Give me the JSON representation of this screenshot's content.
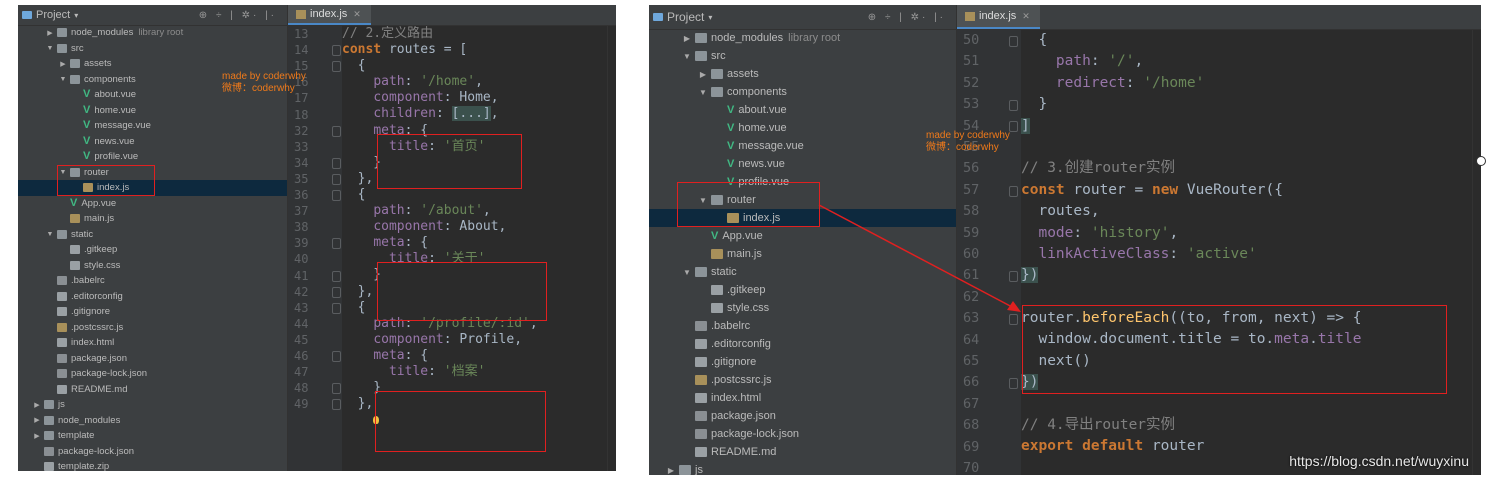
{
  "left": {
    "project_label": "Project",
    "toolbar_icons": "⊕ ÷ | ✲· |·",
    "tab": "index.js",
    "tree": [
      {
        "label": "node_modules",
        "extra": "library root",
        "icon": "folder",
        "arrow": "▶",
        "indent": 1
      },
      {
        "label": "src",
        "icon": "folder",
        "arrow": "▼",
        "indent": 1
      },
      {
        "label": "assets",
        "icon": "folder",
        "arrow": "▶",
        "indent": 2
      },
      {
        "label": "components",
        "icon": "folder",
        "arrow": "▼",
        "indent": 2
      },
      {
        "label": "about.vue",
        "icon": "vue",
        "indent": 3
      },
      {
        "label": "home.vue",
        "icon": "vue",
        "indent": 3
      },
      {
        "label": "message.vue",
        "icon": "vue",
        "indent": 3
      },
      {
        "label": "news.vue",
        "icon": "vue",
        "indent": 3
      },
      {
        "label": "profile.vue",
        "icon": "vue",
        "indent": 3
      },
      {
        "label": "router",
        "icon": "folder",
        "arrow": "▼",
        "indent": 2
      },
      {
        "label": "index.js",
        "icon": "js",
        "indent": 3,
        "selected": true
      },
      {
        "label": "App.vue",
        "icon": "vue",
        "indent": 2
      },
      {
        "label": "main.js",
        "icon": "js",
        "indent": 2
      },
      {
        "label": "static",
        "icon": "folder",
        "arrow": "▼",
        "indent": 1
      },
      {
        "label": ".gitkeep",
        "icon": "file",
        "indent": 2
      },
      {
        "label": "style.css",
        "icon": "file",
        "indent": 2
      },
      {
        "label": ".babelrc",
        "icon": "json",
        "indent": 1
      },
      {
        "label": ".editorconfig",
        "icon": "file",
        "indent": 1
      },
      {
        "label": ".gitignore",
        "icon": "file",
        "indent": 1
      },
      {
        "label": ".postcssrc.js",
        "icon": "js",
        "indent": 1
      },
      {
        "label": "index.html",
        "icon": "file",
        "indent": 1
      },
      {
        "label": "package.json",
        "icon": "json",
        "indent": 1
      },
      {
        "label": "package-lock.json",
        "icon": "json",
        "indent": 1
      },
      {
        "label": "README.md",
        "icon": "file",
        "indent": 1
      },
      {
        "label": "js",
        "icon": "folder",
        "arrow": "▶",
        "indent": 0
      },
      {
        "label": "node_modules",
        "icon": "folder",
        "arrow": "▶",
        "indent": 0
      },
      {
        "label": "template",
        "icon": "folder",
        "arrow": "▶",
        "indent": 0
      },
      {
        "label": "package-lock.json",
        "icon": "json",
        "indent": 0
      },
      {
        "label": "template.zip",
        "icon": "file",
        "indent": 0
      }
    ],
    "note": [
      "made by coderwhy",
      "微博：coderwhy"
    ],
    "code": [
      {
        "n": "13",
        "html": "<span class=\"cmt\">// 2.定义路由</span>"
      },
      {
        "n": "14",
        "html": "<span class=\"kw\">const</span> routes = ["
      },
      {
        "n": "15",
        "html": "  {"
      },
      {
        "n": "16",
        "html": "    <span class=\"prop\">path</span>: <span class=\"str\">'/home'</span>,"
      },
      {
        "n": "17",
        "html": "    <span class=\"prop\">component</span>: Home,"
      },
      {
        "n": "18",
        "html": "    <span class=\"prop\">children</span>: <span class=\"hl\">[...]</span>,"
      },
      {
        "n": "32",
        "html": "    <span class=\"prop\">meta</span>: {"
      },
      {
        "n": "33",
        "html": "      <span class=\"prop\">title</span>: <span class=\"str\">'首页'</span>"
      },
      {
        "n": "34",
        "html": "    }"
      },
      {
        "n": "35",
        "html": "  },"
      },
      {
        "n": "36",
        "html": "  {"
      },
      {
        "n": "37",
        "html": "    <span class=\"prop\">path</span>: <span class=\"str\">'/about'</span>,"
      },
      {
        "n": "38",
        "html": "    <span class=\"prop\">component</span>: About,"
      },
      {
        "n": "39",
        "html": "    <span class=\"prop\">meta</span>: {"
      },
      {
        "n": "40",
        "html": "      <span class=\"prop\">title</span>: <span class=\"str\">'关于'</span>"
      },
      {
        "n": "41",
        "html": "    }"
      },
      {
        "n": "42",
        "html": "  },"
      },
      {
        "n": "43",
        "html": "  {"
      },
      {
        "n": "44",
        "html": "    <span class=\"prop\">path</span>: <span class=\"str\">'/profile/:id'</span>,"
      },
      {
        "n": "45",
        "html": "    <span class=\"prop\">component</span>: Profile,"
      },
      {
        "n": "46",
        "html": "    <span class=\"prop\">meta</span>: {"
      },
      {
        "n": "47",
        "html": "      <span class=\"prop\">title</span>: <span class=\"str\">'档案'</span>"
      },
      {
        "n": "48",
        "html": "    }"
      },
      {
        "n": "49",
        "html": "  },"
      }
    ]
  },
  "right": {
    "project_label": "Project",
    "toolbar_icons": "⊕ ÷ | ✲· |·",
    "tab": "index.js",
    "tree": [
      {
        "label": "node_modules",
        "extra": "library root",
        "icon": "folder",
        "arrow": "▶",
        "indent": 1
      },
      {
        "label": "src",
        "icon": "folder",
        "arrow": "▼",
        "indent": 1
      },
      {
        "label": "assets",
        "icon": "folder",
        "arrow": "▶",
        "indent": 2
      },
      {
        "label": "components",
        "icon": "folder",
        "arrow": "▼",
        "indent": 2
      },
      {
        "label": "about.vue",
        "icon": "vue",
        "indent": 3
      },
      {
        "label": "home.vue",
        "icon": "vue",
        "indent": 3
      },
      {
        "label": "message.vue",
        "icon": "vue",
        "indent": 3
      },
      {
        "label": "news.vue",
        "icon": "vue",
        "indent": 3
      },
      {
        "label": "profile.vue",
        "icon": "vue",
        "indent": 3
      },
      {
        "label": "router",
        "icon": "folder",
        "arrow": "▼",
        "indent": 2
      },
      {
        "label": "index.js",
        "icon": "js",
        "indent": 3,
        "selected": true
      },
      {
        "label": "App.vue",
        "icon": "vue",
        "indent": 2
      },
      {
        "label": "main.js",
        "icon": "js",
        "indent": 2
      },
      {
        "label": "static",
        "icon": "folder",
        "arrow": "▼",
        "indent": 1
      },
      {
        "label": ".gitkeep",
        "icon": "file",
        "indent": 2
      },
      {
        "label": "style.css",
        "icon": "file",
        "indent": 2
      },
      {
        "label": ".babelrc",
        "icon": "json",
        "indent": 1
      },
      {
        "label": ".editorconfig",
        "icon": "file",
        "indent": 1
      },
      {
        "label": ".gitignore",
        "icon": "file",
        "indent": 1
      },
      {
        "label": ".postcssrc.js",
        "icon": "js",
        "indent": 1
      },
      {
        "label": "index.html",
        "icon": "file",
        "indent": 1
      },
      {
        "label": "package.json",
        "icon": "json",
        "indent": 1
      },
      {
        "label": "package-lock.json",
        "icon": "json",
        "indent": 1
      },
      {
        "label": "README.md",
        "icon": "file",
        "indent": 1
      },
      {
        "label": "js",
        "icon": "folder",
        "arrow": "▶",
        "indent": 0
      }
    ],
    "note": [
      "made by coderwhy",
      "微博：coderwhy"
    ],
    "watermark": "https://blog.csdn.net/wuyxinu",
    "code": [
      {
        "n": "50",
        "html": "  {"
      },
      {
        "n": "51",
        "html": "    <span class=\"prop\">path</span>: <span class=\"str\">'/'</span>,"
      },
      {
        "n": "52",
        "html": "    <span class=\"prop\">redirect</span>: <span class=\"str\">'/home'</span>"
      },
      {
        "n": "53",
        "html": "  }"
      },
      {
        "n": "54",
        "html": "<span class=\"hl\">]</span>"
      },
      {
        "n": "55",
        "html": ""
      },
      {
        "n": "56",
        "html": "<span class=\"cmt\">// 3.创建router实例</span>"
      },
      {
        "n": "57",
        "html": "<span class=\"kw\">const</span> router = <span class=\"kw\">new</span> VueRouter({"
      },
      {
        "n": "58",
        "html": "  routes,"
      },
      {
        "n": "59",
        "html": "  <span class=\"prop\">mode</span>: <span class=\"str\">'history'</span>,"
      },
      {
        "n": "60",
        "html": "  <span class=\"prop\">linkActiveClass</span>: <span class=\"str\">'active'</span>"
      },
      {
        "n": "61",
        "html": "<span class=\"hl\">})</span>"
      },
      {
        "n": "62",
        "html": ""
      },
      {
        "n": "63",
        "html": "router.<span class=\"fn\">beforeEach</span>((to, from, next) => {"
      },
      {
        "n": "64",
        "html": "  window.document.title = to.<span class=\"prop\">meta</span>.<span class=\"prop\">title</span>"
      },
      {
        "n": "65",
        "html": "  next()"
      },
      {
        "n": "66",
        "html": "<span class=\"hl\">})</span>"
      },
      {
        "n": "67",
        "html": ""
      },
      {
        "n": "68",
        "html": "<span class=\"cmt\">// 4.导出router实例</span>"
      },
      {
        "n": "69",
        "html": "<span class=\"kw\">export default</span> router"
      },
      {
        "n": "70",
        "html": ""
      }
    ]
  }
}
